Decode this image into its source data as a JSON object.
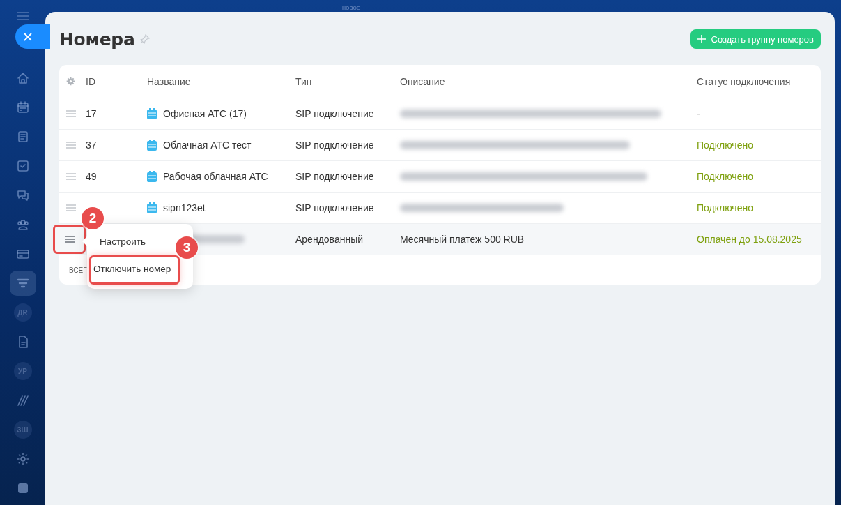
{
  "topbar": {
    "label": "НОВОЕ"
  },
  "sidebar": {
    "items": [
      {
        "kind": "home",
        "selected": false
      },
      {
        "kind": "calendar",
        "selected": false
      },
      {
        "kind": "feed",
        "selected": false
      },
      {
        "kind": "tasks",
        "selected": false
      },
      {
        "kind": "chat",
        "selected": false
      },
      {
        "kind": "contacts",
        "selected": false
      },
      {
        "kind": "card",
        "selected": false
      },
      {
        "kind": "filter",
        "selected": true
      },
      {
        "kind": "initials",
        "text": "ДR",
        "selected": false
      },
      {
        "kind": "doc",
        "selected": false
      },
      {
        "kind": "initials",
        "text": "УР",
        "selected": false
      },
      {
        "kind": "stripes",
        "selected": false
      },
      {
        "kind": "initials",
        "text": "ЗШ",
        "selected": false
      },
      {
        "kind": "gear",
        "selected": false
      },
      {
        "kind": "tile",
        "selected": false
      }
    ]
  },
  "page": {
    "title": "Номера",
    "create_button": "Создать группу номеров"
  },
  "table": {
    "columns": [
      "ID",
      "Название",
      "Тип",
      "Описание",
      "Статус подключения"
    ],
    "rows": [
      {
        "id": "17",
        "name": {
          "kind": "text",
          "text": "Офисная АТС (17)"
        },
        "type": "SIP подключение",
        "description": {
          "kind": "blurred"
        },
        "status": {
          "kind": "none",
          "text": "-"
        },
        "selected": false,
        "annotated": false
      },
      {
        "id": "37",
        "name": {
          "kind": "text",
          "text": "Облачная АТС тест"
        },
        "type": "SIP подключение",
        "description": {
          "kind": "blurred"
        },
        "status": {
          "kind": "ok",
          "text": "Подключено"
        },
        "selected": false,
        "annotated": false
      },
      {
        "id": "49",
        "name": {
          "kind": "text",
          "text": "Рабочая облачная АТС"
        },
        "type": "SIP подключение",
        "description": {
          "kind": "blurred"
        },
        "status": {
          "kind": "ok",
          "text": "Подключено"
        },
        "selected": false,
        "annotated": false
      },
      {
        "name": {
          "kind": "text",
          "text": "sipn123et"
        },
        "type": "SIP подключение",
        "description": {
          "kind": "blurred"
        },
        "status": {
          "kind": "ok",
          "text": "Подключено"
        },
        "selected": false,
        "annotated": false
      },
      {
        "name": {
          "kind": "blurred"
        },
        "type": "Арендованный",
        "description": {
          "kind": "text",
          "text": "Месячный платеж 500 RUB"
        },
        "status": {
          "kind": "ok",
          "text": "Оплачен до 15.08.2025"
        },
        "selected": true,
        "annotated": true
      }
    ],
    "footer": "ВСЕГ"
  },
  "row_menu": {
    "items": [
      {
        "label": "Настроить",
        "annotated": false
      },
      {
        "label": "Отключить номер",
        "annotated": true
      }
    ]
  },
  "callouts": [
    {
      "number": "2"
    },
    {
      "number": "3"
    }
  ]
}
